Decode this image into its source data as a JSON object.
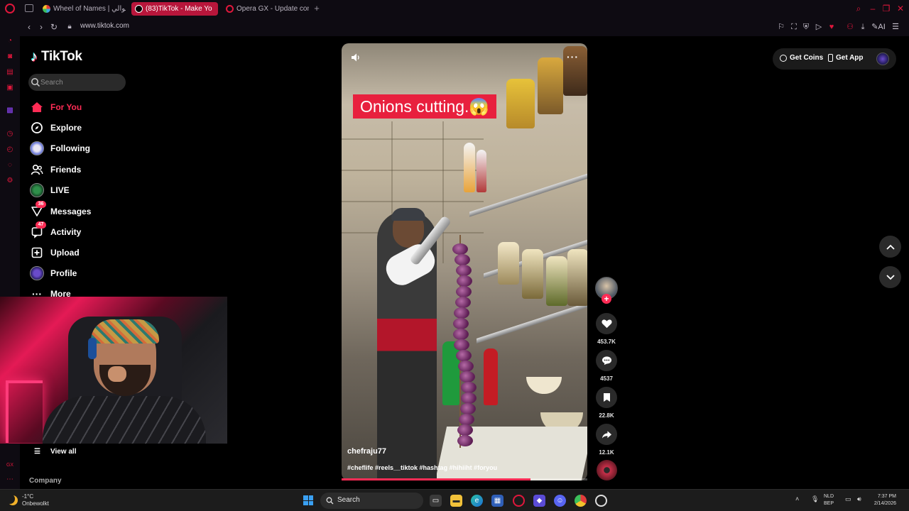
{
  "browser": {
    "tabs": [
      {
        "label": "Wheel of Names | الشوالي",
        "favicon_color": "#3ea7e0"
      },
      {
        "label": "(83)TikTok - Make Yo",
        "favicon_color": "#000000"
      },
      {
        "label": "Opera GX - Update comp",
        "favicon_color": "#e0173c"
      }
    ],
    "url": "www.tiktok.com"
  },
  "tiktok": {
    "logo_text": "TikTok",
    "search_placeholder": "Search",
    "nav": [
      {
        "label": "For You",
        "icon": "home-icon",
        "active": true
      },
      {
        "label": "Explore",
        "icon": "compass-icon"
      },
      {
        "label": "Following",
        "icon": "following-avatar"
      },
      {
        "label": "Friends",
        "icon": "friends-icon"
      },
      {
        "label": "LIVE",
        "icon": "live-avatar"
      },
      {
        "label": "Messages",
        "icon": "messages-icon",
        "badge": "36"
      },
      {
        "label": "Activity",
        "icon": "activity-icon",
        "badge": "47"
      },
      {
        "label": "Upload",
        "icon": "upload-icon"
      },
      {
        "label": "Profile",
        "icon": "profile-avatar"
      },
      {
        "label": "More",
        "icon": "more-icon"
      }
    ],
    "view_all": "View all",
    "company": "Company",
    "header": {
      "get_coins": "Get Coins",
      "get_app": "Get App"
    },
    "video": {
      "caption": "Onions cutting.😱",
      "author": "chefraju77",
      "hashtags": "#cheflife #reels__tiktok #hashtag #hihiiht #foryou",
      "progress": 0.77
    },
    "actions": {
      "likes": "453.7K",
      "comments": "4537",
      "saves": "22.8K",
      "shares": "12.1K"
    }
  },
  "taskbar": {
    "weather_temp": "-1°C",
    "weather_desc": "Onbewolkt",
    "search_label": "Search",
    "lang_top": "NLD",
    "lang_bottom": "BEP",
    "time": "7:37 PM",
    "date": "2/14/2026"
  },
  "colors": {
    "accent": "#fe2c55",
    "opera_red": "#e0173c",
    "active_tab": "#b8163b"
  }
}
